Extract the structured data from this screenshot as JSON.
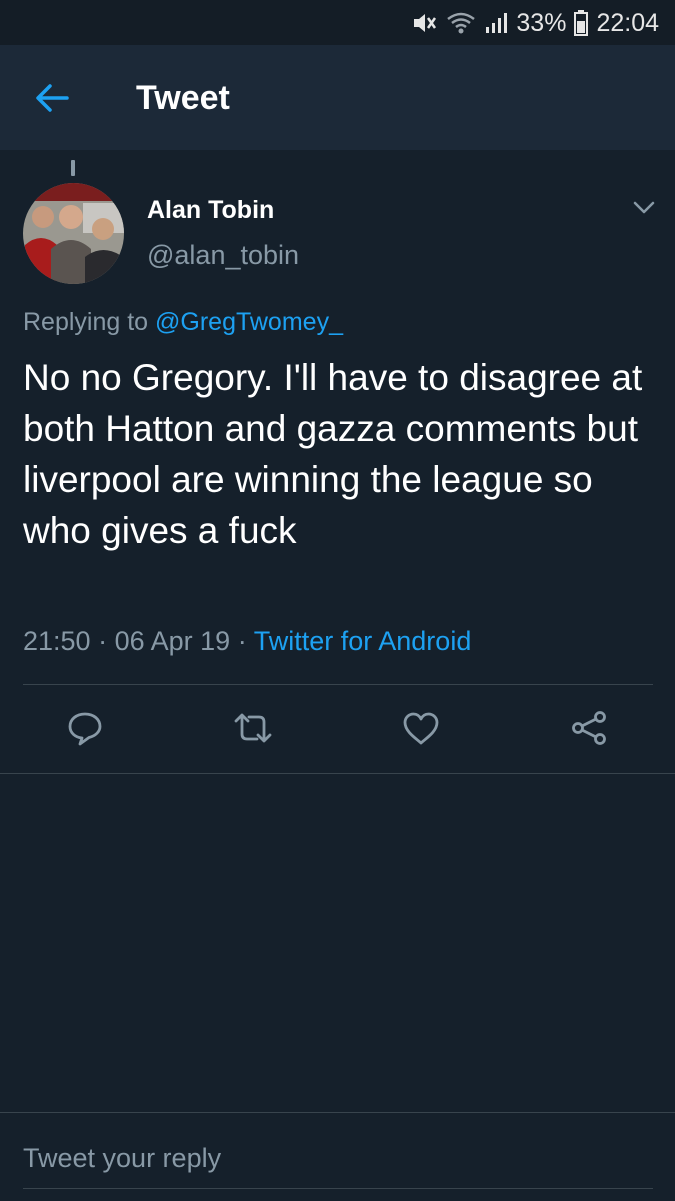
{
  "status_bar": {
    "battery": "33%",
    "time": "22:04",
    "icons": [
      "mute-icon",
      "wifi-icon",
      "signal-icon",
      "battery-icon"
    ]
  },
  "app_bar": {
    "title": "Tweet",
    "back_icon": "arrow-left-icon"
  },
  "tweet": {
    "author_name": "Alan Tobin",
    "author_handle": "@alan_tobin",
    "replying_prefix": "Replying to",
    "replying_to": "@GregTwomey_",
    "text": "No no Gregory. I'll have to disagree at both Hatton and gazza comments but liverpool are winning the league so who gives a fuck",
    "time": "21:50",
    "date": "06 Apr 19",
    "source": "Twitter for Android",
    "separator": "·"
  },
  "actions": [
    {
      "name": "reply",
      "icon": "comment-icon"
    },
    {
      "name": "retweet",
      "icon": "retweet-icon"
    },
    {
      "name": "like",
      "icon": "heart-icon"
    },
    {
      "name": "share",
      "icon": "share-icon"
    }
  ],
  "reply_box": {
    "placeholder": "Tweet your reply"
  },
  "colors": {
    "background": "#15202b",
    "app_bar": "#1c2938",
    "accent": "#1da1f2",
    "secondary_text": "#8899a6",
    "divider": "#38444d"
  }
}
